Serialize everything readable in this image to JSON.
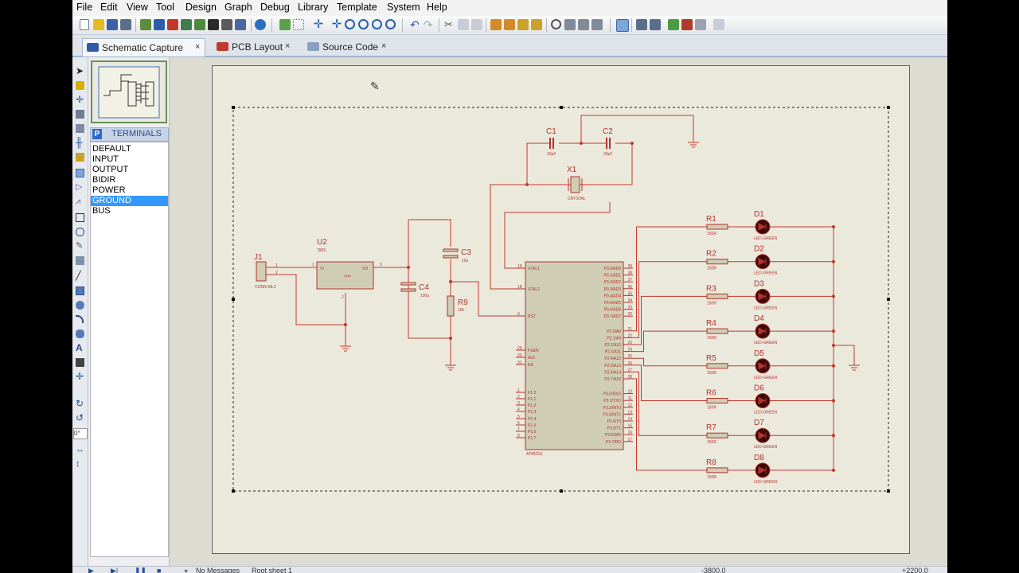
{
  "menu": [
    "File",
    "Edit",
    "View",
    "Tool",
    "Design",
    "Graph",
    "Debug",
    "Library",
    "Template",
    "System",
    "Help"
  ],
  "tabs": [
    {
      "label": "Schematic Capture",
      "icon": "isis-icon",
      "active": true
    },
    {
      "label": "PCB Layout",
      "icon": "ares-icon",
      "active": false
    },
    {
      "label": "Source Code",
      "icon": "source-code-icon",
      "active": false
    }
  ],
  "close_glyph": "×",
  "terminals": {
    "header_letter": "P",
    "header": "TERMINALS",
    "items": [
      "DEFAULT",
      "INPUT",
      "OUTPUT",
      "BIDIR",
      "POWER",
      "GROUND",
      "BUS"
    ],
    "selected": "GROUND"
  },
  "rotation_field": "0°",
  "status": {
    "messages": "No Messages",
    "sheet": "Root sheet 1",
    "coord_x": "-3800.0",
    "coord_y": "+2200.0"
  },
  "schematic": {
    "j1": {
      "ref": "J1",
      "value": "CONN-SIL2",
      "pin1": "1",
      "pin2": "2"
    },
    "u2": {
      "ref": "U2",
      "value": "7805",
      "vi": "VI",
      "vo": "VO",
      "gnd": "GND",
      "pin_in": "1",
      "pin_out": "3",
      "pin_gnd": "2"
    },
    "c1": {
      "ref": "C1",
      "value": "33pF"
    },
    "c2": {
      "ref": "C2",
      "value": "33pF"
    },
    "c3": {
      "ref": "C3",
      "value": "10u"
    },
    "c4": {
      "ref": "C4",
      "value": "100u"
    },
    "x1": {
      "ref": "X1",
      "value": "CRYSTAL"
    },
    "r9": {
      "ref": "R9",
      "value": "10k"
    },
    "mcu": {
      "value": "AT89C51",
      "left_pins": [
        {
          "name": "XTAL1",
          "num": "19"
        },
        {
          "name": "XTAL2",
          "num": "18"
        },
        {
          "name": "RST",
          "num": "9"
        },
        {
          "name": "PSEN",
          "num": "29"
        },
        {
          "name": "ALE",
          "num": "30"
        },
        {
          "name": "EA",
          "num": "31"
        },
        {
          "name": "P1.0",
          "num": "1"
        },
        {
          "name": "P1.1",
          "num": "2"
        },
        {
          "name": "P1.2",
          "num": "3"
        },
        {
          "name": "P1.3",
          "num": "4"
        },
        {
          "name": "P1.4",
          "num": "5"
        },
        {
          "name": "P1.5",
          "num": "6"
        },
        {
          "name": "P1.6",
          "num": "7"
        },
        {
          "name": "P1.7",
          "num": "8"
        }
      ],
      "right_pins": [
        {
          "name": "P0.0/AD0",
          "num": "39"
        },
        {
          "name": "P0.1/AD1",
          "num": "38"
        },
        {
          "name": "P0.2/AD2",
          "num": "37"
        },
        {
          "name": "P0.3/AD3",
          "num": "36"
        },
        {
          "name": "P0.4/AD4",
          "num": "35"
        },
        {
          "name": "P0.5/AD5",
          "num": "34"
        },
        {
          "name": "P0.6/AD6",
          "num": "33"
        },
        {
          "name": "P0.7/AD7",
          "num": "32"
        },
        {
          "name": "P2.0/A8",
          "num": "21"
        },
        {
          "name": "P2.1/A9",
          "num": "22"
        },
        {
          "name": "P2.2/A10",
          "num": "23"
        },
        {
          "name": "P2.3/A11",
          "num": "24"
        },
        {
          "name": "P2.4/A12",
          "num": "25"
        },
        {
          "name": "P2.5/A13",
          "num": "26"
        },
        {
          "name": "P2.6/A14",
          "num": "27"
        },
        {
          "name": "P2.7/A15",
          "num": "28"
        },
        {
          "name": "P3.0/RXD",
          "num": "10"
        },
        {
          "name": "P3.1/TXD",
          "num": "11"
        },
        {
          "name": "P3.2/INT0",
          "num": "12"
        },
        {
          "name": "P3.3/INT1",
          "num": "13"
        },
        {
          "name": "P3.4/T0",
          "num": "14"
        },
        {
          "name": "P3.5/T1",
          "num": "15"
        },
        {
          "name": "P3.6/WR",
          "num": "16"
        },
        {
          "name": "P3.7/RD",
          "num": "17"
        }
      ]
    },
    "led_rows": [
      {
        "r": "R1",
        "rv": "150R",
        "d": "D1",
        "dv": "LED-GREEN"
      },
      {
        "r": "R2",
        "rv": "150R",
        "d": "D2",
        "dv": "LED-GREEN"
      },
      {
        "r": "R3",
        "rv": "150R",
        "d": "D3",
        "dv": "LED-GREEN"
      },
      {
        "r": "R4",
        "rv": "150R",
        "d": "D4",
        "dv": "LED-GREEN"
      },
      {
        "r": "R5",
        "rv": "150R",
        "d": "D5",
        "dv": "LED-GREEN"
      },
      {
        "r": "R6",
        "rv": "150R",
        "d": "D6",
        "dv": "LED-GREEN"
      },
      {
        "r": "R7",
        "rv": "150R",
        "d": "D7",
        "dv": "LED-GREEN"
      },
      {
        "r": "R8",
        "rv": "150R",
        "d": "D8",
        "dv": "LED-GREEN"
      }
    ]
  },
  "colors": {
    "wire": "#c0392b",
    "part_fill": "#cfcdb4",
    "part_stroke": "#b3332d",
    "selection": "#3399ff",
    "sheet_bg": "#ebe9dc"
  }
}
